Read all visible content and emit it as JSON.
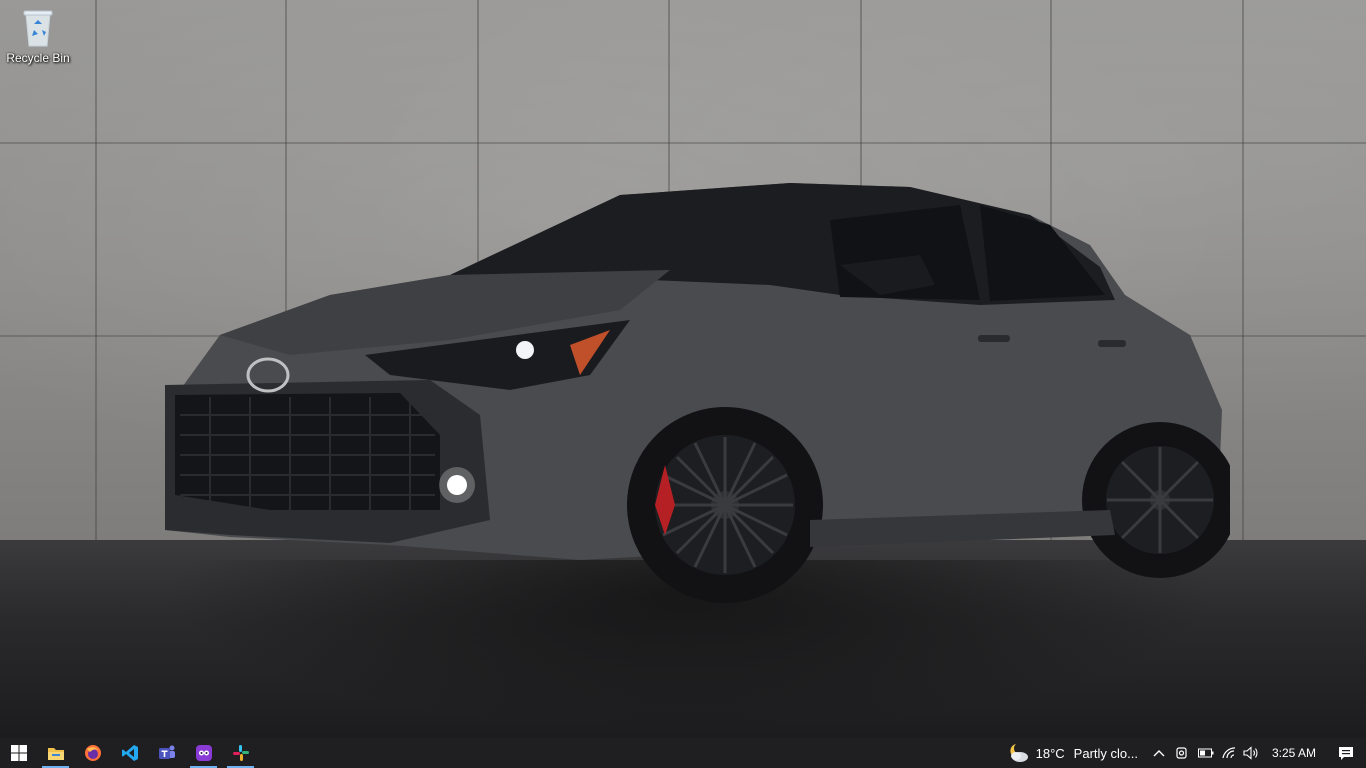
{
  "desktop": {
    "icons": [
      {
        "label": "Recycle Bin",
        "icon": "recycle-bin-icon"
      }
    ],
    "wallpaper": "dark grey hatchback in front of concrete wall"
  },
  "taskbar": {
    "start_icon": "windows-start-icon",
    "pinned": [
      {
        "name": "file-explorer",
        "icon": "folder-icon",
        "active": true
      },
      {
        "name": "firefox",
        "icon": "firefox-icon",
        "active": false
      },
      {
        "name": "vscode",
        "icon": "vscode-icon",
        "active": false
      },
      {
        "name": "teams",
        "icon": "teams-icon",
        "active": false
      },
      {
        "name": "app-purple",
        "icon": "purple-app-icon",
        "active": true
      },
      {
        "name": "slack",
        "icon": "slack-icon",
        "active": true
      }
    ],
    "tray": {
      "temperature": "18°C",
      "weather": "Partly clo...",
      "time": "3:25 AM"
    }
  },
  "colors": {
    "taskbar_bg": "#1f1f22",
    "active_indicator": "#6fb2ef"
  }
}
